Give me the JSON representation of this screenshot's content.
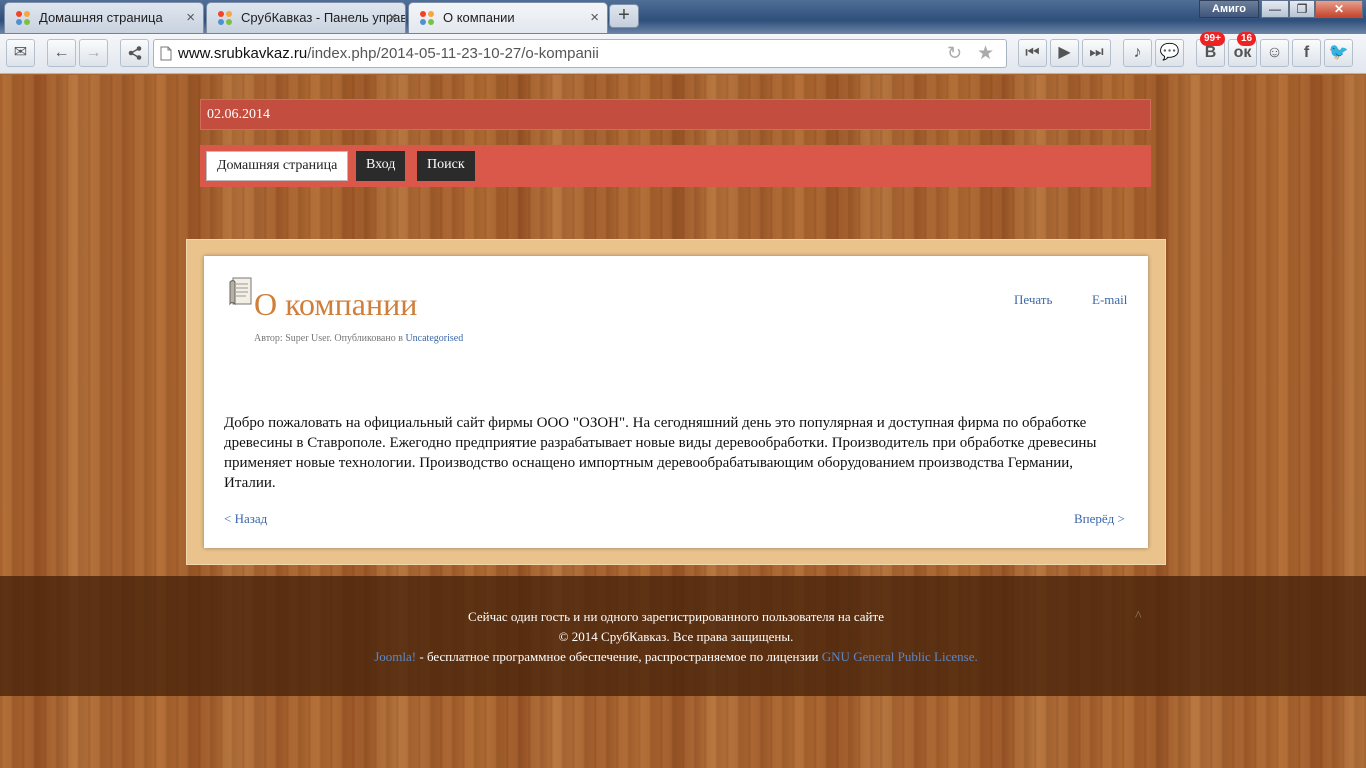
{
  "browser": {
    "tabs": [
      {
        "label": "Домашняя страница",
        "active": false
      },
      {
        "label": "СрубКавказ - Панель управ",
        "active": false
      },
      {
        "label": "О компании",
        "active": true
      }
    ],
    "new_tab_label": "+",
    "profile_label": "Амиго",
    "url_host": "www.srubkavkaz.ru",
    "url_path": "/index.php/2014-05-11-23-10-27/o-kompanii",
    "badges": {
      "vk": "99+",
      "ok": "16"
    },
    "icons": [
      "mail-icon",
      "back-icon",
      "forward-icon",
      "share-icon",
      "reload-icon",
      "star-icon",
      "prev-track-icon",
      "play-icon",
      "next-track-icon",
      "music-icon",
      "chat-icon",
      "vk-icon",
      "odnoklassniki-icon",
      "friends-icon",
      "facebook-icon",
      "twitter-icon"
    ]
  },
  "site": {
    "date": "02.06.2014",
    "nav": [
      {
        "label": "Домашняя страница",
        "active": true
      },
      {
        "label": "Вход",
        "active": false
      },
      {
        "label": "Поиск",
        "active": false
      }
    ]
  },
  "article": {
    "title": "О компании",
    "meta_prefix": "Автор: Super User. Опубликовано в ",
    "category": "Uncategorised",
    "print_label": "Печать",
    "email_label": "E-mail",
    "body": "Добро пожаловать на официальный сайт фирмы  ООО \"ОЗОН\". На сегодняшний день это популярная и доступная фирма по обработке древесины в Ставрополе. Ежегодно предприятие разрабатывает новые виды деревообработки.  Производитель при обработке древесины применяет новые технологии. Производство оснащено импортным деревообрабатывающим оборудованием производства Германии, Италии.",
    "prev_label": "< Назад",
    "next_label": "Вперёд >"
  },
  "footer": {
    "online": "Сейчас один гость и ни одного зарегистрированного пользователя на сайте",
    "copyright": "© 2014 СрубКавказ. Все права защищены.",
    "joomla_link": "Joomla!",
    "license_text": " - бесплатное программное обеспечение, распространяемое по лицензии ",
    "license_link": "GNU General Public License."
  },
  "colors": {
    "date_bar": "#c34d3e",
    "nav_bar": "#d9584a",
    "title": "#cf7f3b",
    "link": "#3a67a8"
  }
}
